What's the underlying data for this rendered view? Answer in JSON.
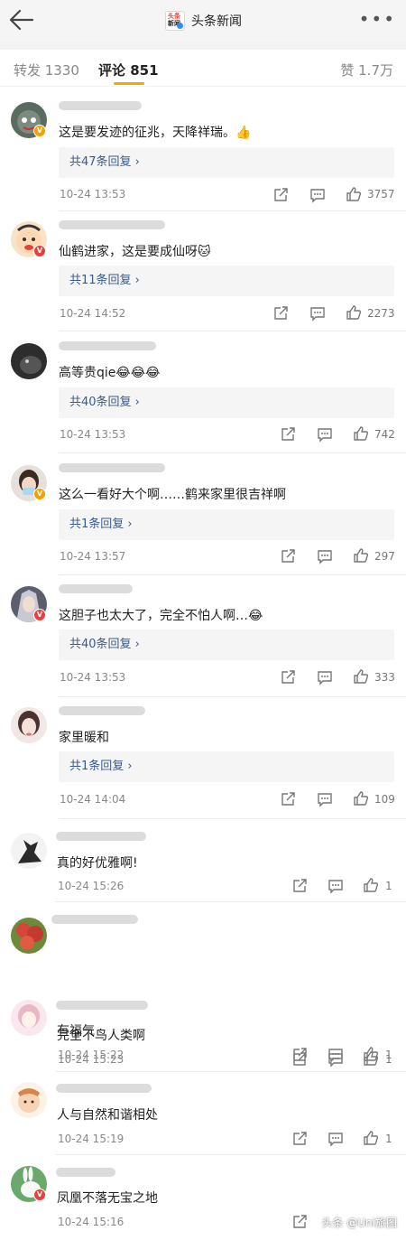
{
  "header": {
    "title": "头条新闻",
    "logo_text_top": "头条",
    "logo_text_bottom": "新闻"
  },
  "tabs": {
    "repost": "转发 1330",
    "comments": "评论 851",
    "likes": "赞 1.7万"
  },
  "comments": [
    {
      "text": "这是要发迹的征兆，天降祥瑞。👍",
      "replies": "共47条回复 ›",
      "time": "10-24 13:53",
      "likes": "3757"
    },
    {
      "text": "仙鹤进家，这是要成仙呀🐱",
      "replies": "共11条回复 ›",
      "time": "10-24 14:52",
      "likes": "2273"
    },
    {
      "text": "高等贵qie😂😂😂",
      "replies": "共40条回复 ›",
      "time": "10-24 13:53",
      "likes": "742"
    },
    {
      "text": "这么一看好大个啊……鹤来家里很吉祥啊",
      "replies": "共1条回复 ›",
      "time": "10-24 13:57",
      "likes": "297"
    },
    {
      "text": "这胆子也太大了，完全不怕人啊…😂",
      "replies": "共40条回复 ›",
      "time": "10-24 13:53",
      "likes": "333"
    },
    {
      "text": "家里暖和",
      "replies": "共1条回复 ›",
      "time": "10-24 14:04",
      "likes": "109"
    },
    {
      "text": "真的好优雅啊!",
      "time": "10-24 15:26",
      "likes": "1"
    },
    {
      "text": "完全不鸟人类啊",
      "time": "10-24 15:23",
      "likes": "1"
    },
    {
      "text": "有福气",
      "time": "10-24 15:22",
      "likes": "1"
    },
    {
      "text": "人与自然和谐相处",
      "time": "10-24 15:19",
      "likes": "1"
    },
    {
      "text": "凤凰不落无宝之地",
      "time": "10-24 15:16",
      "likes": ""
    }
  ],
  "watermark": "头条 @Uni旅图"
}
